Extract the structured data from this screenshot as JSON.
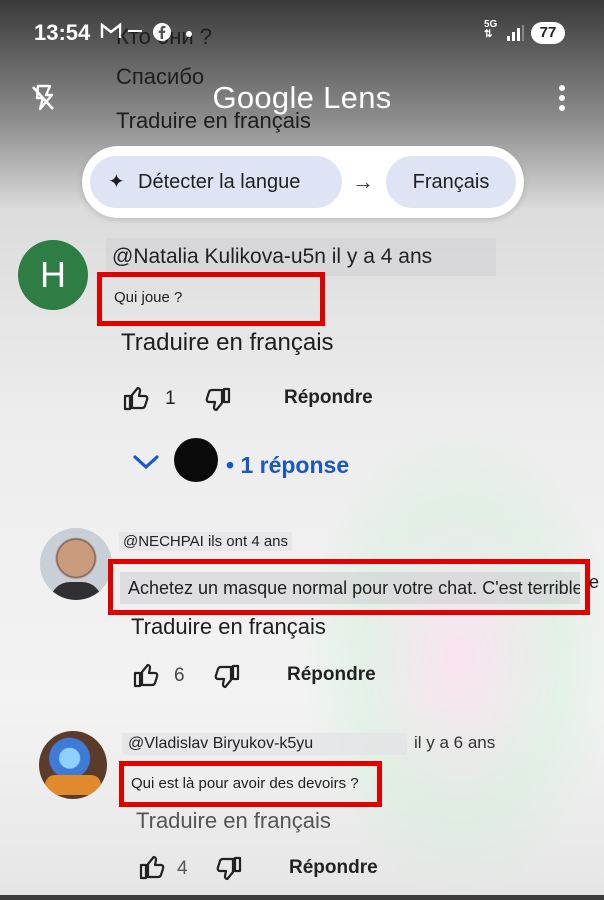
{
  "status_bar": {
    "time": "13:54",
    "network": "5G",
    "battery": "77"
  },
  "background_fragments": {
    "line1": "Кто они ?",
    "line2": "Спасибо",
    "line3": "Traduire en français"
  },
  "header": {
    "title": "Google Lens"
  },
  "language": {
    "source": "Détecter la langue",
    "target": "Français"
  },
  "comments": [
    {
      "avatar_letter": "H",
      "handle": "@Natalia Kulikova-u5n il y a 4 ans",
      "text": "Qui joue ?",
      "translate": "Traduire en français",
      "likes": "1",
      "reply": "Répondre",
      "replies": "1 réponse"
    },
    {
      "handle": "@NECHPAI ils ont 4 ans",
      "text": "Achetez un masque normal pour votre chat. C'est terrible",
      "overflow": "e",
      "translate": "Traduire en français",
      "likes": "6",
      "reply": "Répondre"
    },
    {
      "handle": "@Vladislav Biryukov-k5yu",
      "age": "il y a 6 ans",
      "text": "Qui est là pour avoir des devoirs ?",
      "translate": "Traduire en français",
      "likes": "4",
      "reply": "Répondre"
    }
  ],
  "colors": {
    "highlight_box": "#e00000",
    "link_blue": "#1a57c4",
    "pill_bg": "#dfe4f5",
    "avatar_green": "#2e7d45"
  },
  "icons": [
    "flash-off-icon",
    "more-vert-icon",
    "sparkle-icon",
    "arrow-right-icon",
    "thumb-up-icon",
    "thumb-down-icon",
    "chevron-down-icon",
    "gmail-icon",
    "facebook-icon",
    "signal-icon"
  ]
}
